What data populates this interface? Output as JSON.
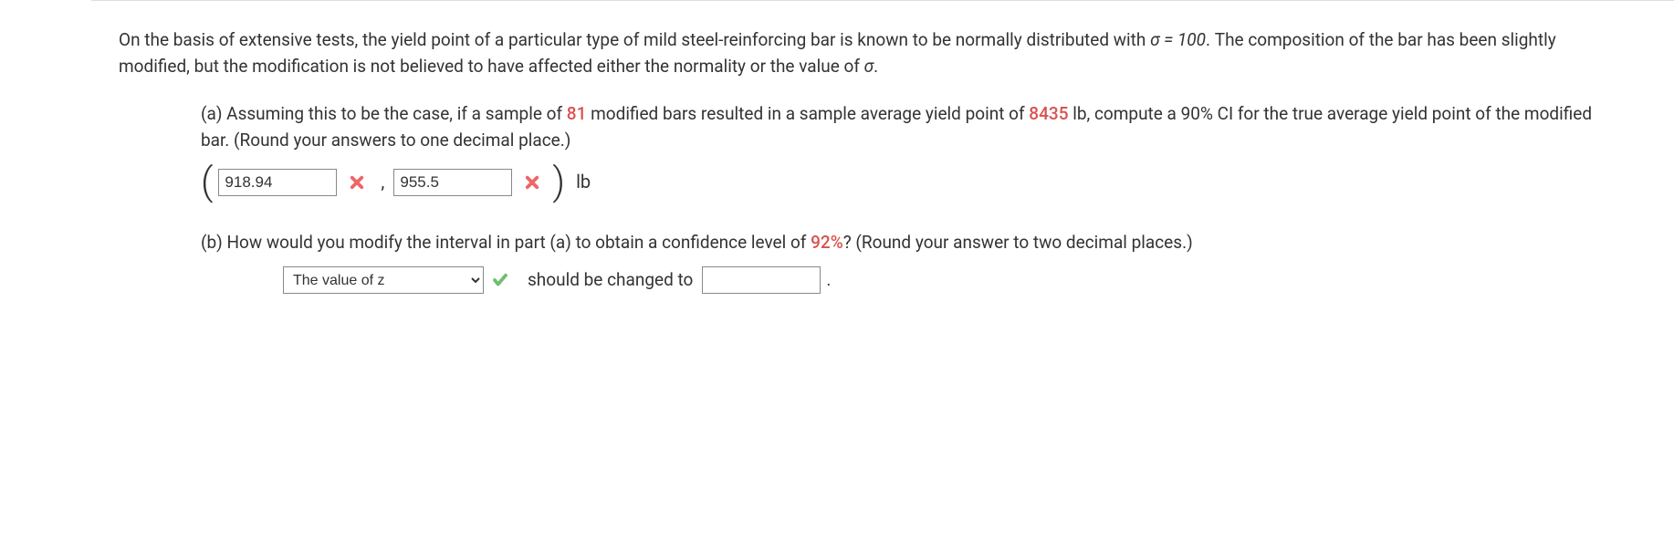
{
  "intro": {
    "text_before_sigma": "On the basis of extensive tests, the yield point of a particular type of mild steel-reinforcing bar is known to be normally distributed with ",
    "sigma_eq": "σ = 100",
    "text_after_sigma": ". The composition of the bar has been slightly modified, but the modification is not believed to have affected either the normality or the value of ",
    "sigma2": "σ",
    "text_end": "."
  },
  "part_a": {
    "label": "(a) ",
    "text_1": "Assuming this to be the case, if a sample of ",
    "n": "81",
    "text_2": " modified bars resulted in a sample average yield point of ",
    "xbar": "8435",
    "text_3": " lb, compute a 90% CI for the true average yield point of the modified bar. (Round your answers to one decimal place.)",
    "paren_open": "(",
    "input1_value": "918.94",
    "comma": ",",
    "input2_value": "955.5",
    "paren_close": ")",
    "unit": "lb"
  },
  "part_b": {
    "label": "(b) ",
    "text_1": "How would you modify the interval in part (a) to obtain a confidence level of ",
    "pct": "92%",
    "text_2": "? (Round your answer to two decimal places.)",
    "dropdown_value": "The value of z",
    "middle_text": "should be changed to",
    "input_value": "",
    "period": "."
  }
}
